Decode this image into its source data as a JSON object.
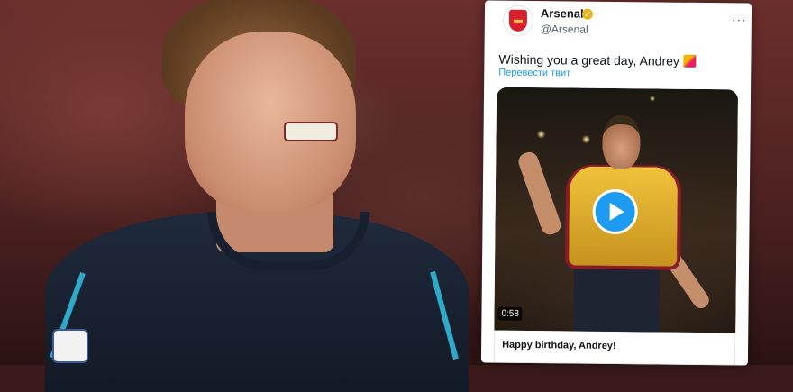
{
  "tweet": {
    "author_name": "Arsenal",
    "author_handle": "@Arsenal",
    "more_label": "···",
    "text": "Wishing you a great day, Andrey",
    "translate_label": "Перевести твит",
    "video_duration": "0:58",
    "caption": "Happy birthday, Andrey!",
    "accent_color": "#1d9bf0",
    "brand_color": "#d6202c"
  },
  "icons": {
    "avatar": "arsenal-crest-icon",
    "verified": "gold-verified-badge-icon",
    "emoji": "party-popper-icon",
    "play": "play-icon"
  }
}
